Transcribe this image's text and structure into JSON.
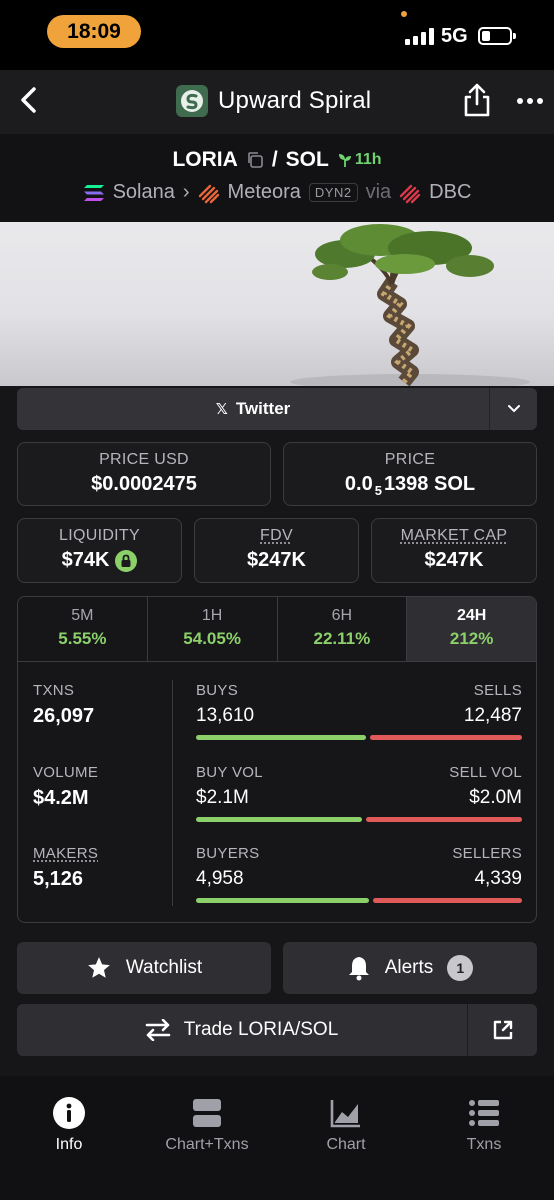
{
  "status_bar": {
    "time": "18:09",
    "network": "5G"
  },
  "header": {
    "title": "Upward Spiral"
  },
  "pair": {
    "base": "LORIA",
    "separator": "/",
    "quote": "SOL",
    "age": "11h",
    "chain": "Solana",
    "dex": "Meteora",
    "dex_tag": "DYN2",
    "via_label": "via",
    "via": "DBC"
  },
  "socials": {
    "label": "Twitter"
  },
  "prices": {
    "price_usd_label": "PRICE USD",
    "price_usd": "$0.0002475",
    "price_label": "PRICE",
    "price_prefix": "0.0",
    "price_zeros": "5",
    "price_rest": "1398 SOL"
  },
  "metrics": {
    "liquidity_label": "LIQUIDITY",
    "liquidity": "$74K",
    "fdv_label": "FDV",
    "fdv": "$247K",
    "mcap_label": "MARKET CAP",
    "mcap": "$247K"
  },
  "timeframes": [
    {
      "label": "5M",
      "change": "5.55%"
    },
    {
      "label": "1H",
      "change": "54.05%"
    },
    {
      "label": "6H",
      "change": "22.11%"
    },
    {
      "label": "24H",
      "change": "212%"
    }
  ],
  "stats": {
    "txns_label": "TXNS",
    "txns": "26,097",
    "volume_label": "VOLUME",
    "volume": "$4.2M",
    "makers_label": "MAKERS",
    "makers": "5,126",
    "buys_label": "BUYS",
    "buys": "13,610",
    "sells_label": "SELLS",
    "sells": "12,487",
    "buy_vol_label": "BUY VOL",
    "buy_vol": "$2.1M",
    "sell_vol_label": "SELL VOL",
    "sell_vol": "$2.0M",
    "buyers_label": "BUYERS",
    "buyers": "4,958",
    "sellers_label": "SELLERS",
    "sellers": "4,339",
    "buys_ratio": 0.52,
    "buy_vol_ratio": 0.51,
    "buyers_ratio": 0.53
  },
  "actions": {
    "watchlist": "Watchlist",
    "alerts": "Alerts",
    "alerts_count": "1",
    "trade": "Trade LORIA/SOL"
  },
  "bottom_nav": [
    {
      "label": "Info",
      "icon": "info-icon"
    },
    {
      "label": "Chart+Txns",
      "icon": "split-layout-icon"
    },
    {
      "label": "Chart",
      "icon": "area-chart-icon"
    },
    {
      "label": "Txns",
      "icon": "list-icon"
    }
  ],
  "colors": {
    "positive": "#8cd06a",
    "negative": "#e05a5a",
    "accent": "#f0a33a"
  }
}
